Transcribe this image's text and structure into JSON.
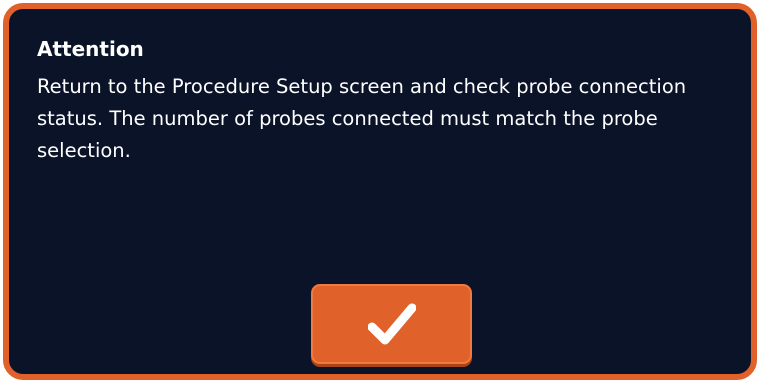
{
  "dialog": {
    "title": "Attention",
    "message": "Return to the Procedure Setup screen and check probe connection status.  The number of probes connected must match the probe selection.",
    "confirm_icon": "checkmark-icon"
  },
  "colors": {
    "background": "#0b1328",
    "accent": "#e0622a",
    "text": "#ffffff"
  }
}
